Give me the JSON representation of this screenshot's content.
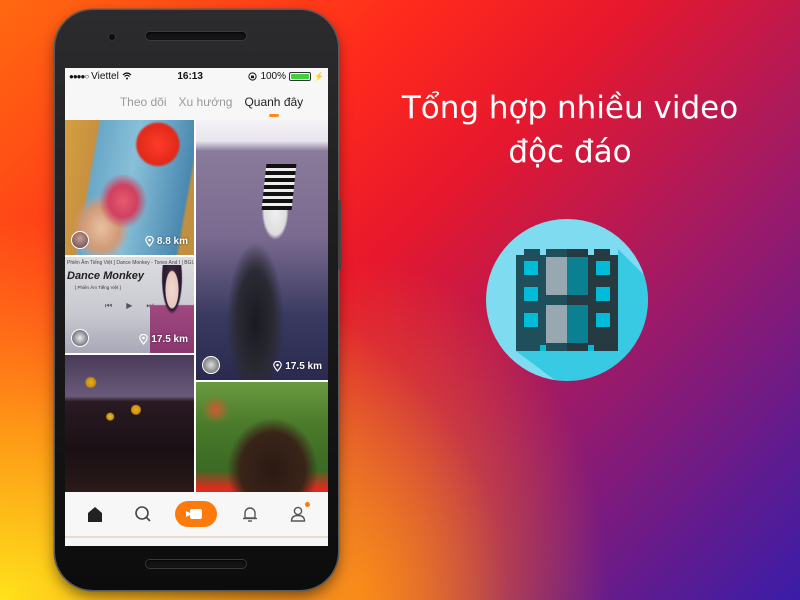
{
  "status_bar": {
    "signal": "●●●●○",
    "carrier": "Viettel",
    "time": "16:13",
    "battery_percent": "100%",
    "icons": [
      "signal-dots-icon",
      "wifi-icon",
      "rotation-lock-icon",
      "battery-icon",
      "charging-bolt-icon"
    ]
  },
  "tabs": [
    {
      "label": "Theo dõi",
      "active": false
    },
    {
      "label": "Xu hướng",
      "active": false
    },
    {
      "label": "Quanh đây",
      "active": true
    }
  ],
  "feed": [
    {
      "distance": "8.8 km"
    },
    {
      "distance": "17.5 km"
    },
    {
      "distance": "17.5 km",
      "caption": "Phiên Âm Tiếng Việt ] Dance Monkey - Tones And I | BGI...",
      "song_title": "Dance Monkey",
      "song_sub": "[ Phiên Âm Tiếng Việt ]"
    },
    {
      "distance": null
    },
    {
      "distance": null
    }
  ],
  "bottom_nav": [
    {
      "name": "home",
      "icon": "home-icon"
    },
    {
      "name": "search",
      "icon": "search-icon"
    },
    {
      "name": "record",
      "icon": "video-camera-icon"
    },
    {
      "name": "notifications",
      "icon": "bell-icon"
    },
    {
      "name": "profile",
      "icon": "user-icon",
      "badge": true
    }
  ],
  "promo": {
    "headline_line1": "Tổng hợp nhiều video",
    "headline_line2": "độc đáo",
    "badge_icon": "film-strip-icon"
  },
  "colors": {
    "accent": "#ff7a0c",
    "badge_bg": "#7edbf0",
    "film_dark": "#1f4f5a"
  }
}
